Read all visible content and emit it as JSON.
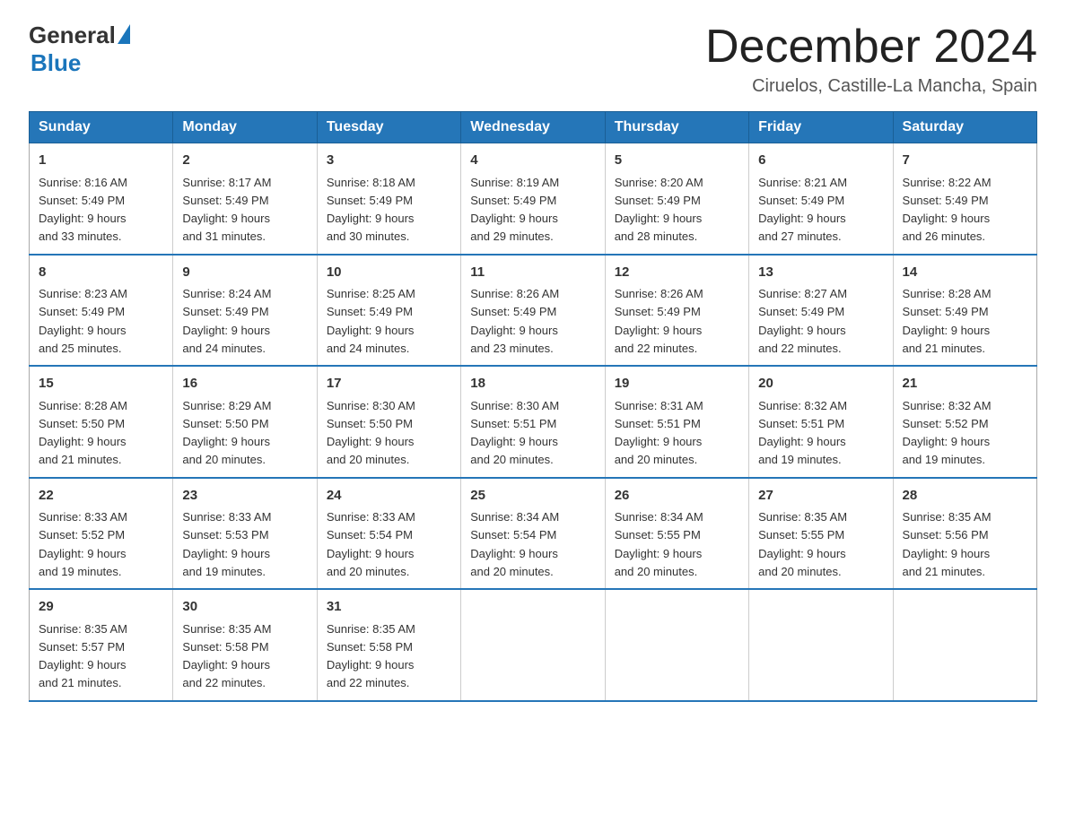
{
  "logo": {
    "general": "General",
    "blue": "Blue"
  },
  "title": {
    "month": "December 2024",
    "location": "Ciruelos, Castille-La Mancha, Spain"
  },
  "headers": [
    "Sunday",
    "Monday",
    "Tuesday",
    "Wednesday",
    "Thursday",
    "Friday",
    "Saturday"
  ],
  "weeks": [
    [
      {
        "day": "1",
        "sunrise": "8:16 AM",
        "sunset": "5:49 PM",
        "daylight": "9 hours and 33 minutes."
      },
      {
        "day": "2",
        "sunrise": "8:17 AM",
        "sunset": "5:49 PM",
        "daylight": "9 hours and 31 minutes."
      },
      {
        "day": "3",
        "sunrise": "8:18 AM",
        "sunset": "5:49 PM",
        "daylight": "9 hours and 30 minutes."
      },
      {
        "day": "4",
        "sunrise": "8:19 AM",
        "sunset": "5:49 PM",
        "daylight": "9 hours and 29 minutes."
      },
      {
        "day": "5",
        "sunrise": "8:20 AM",
        "sunset": "5:49 PM",
        "daylight": "9 hours and 28 minutes."
      },
      {
        "day": "6",
        "sunrise": "8:21 AM",
        "sunset": "5:49 PM",
        "daylight": "9 hours and 27 minutes."
      },
      {
        "day": "7",
        "sunrise": "8:22 AM",
        "sunset": "5:49 PM",
        "daylight": "9 hours and 26 minutes."
      }
    ],
    [
      {
        "day": "8",
        "sunrise": "8:23 AM",
        "sunset": "5:49 PM",
        "daylight": "9 hours and 25 minutes."
      },
      {
        "day": "9",
        "sunrise": "8:24 AM",
        "sunset": "5:49 PM",
        "daylight": "9 hours and 24 minutes."
      },
      {
        "day": "10",
        "sunrise": "8:25 AM",
        "sunset": "5:49 PM",
        "daylight": "9 hours and 24 minutes."
      },
      {
        "day": "11",
        "sunrise": "8:26 AM",
        "sunset": "5:49 PM",
        "daylight": "9 hours and 23 minutes."
      },
      {
        "day": "12",
        "sunrise": "8:26 AM",
        "sunset": "5:49 PM",
        "daylight": "9 hours and 22 minutes."
      },
      {
        "day": "13",
        "sunrise": "8:27 AM",
        "sunset": "5:49 PM",
        "daylight": "9 hours and 22 minutes."
      },
      {
        "day": "14",
        "sunrise": "8:28 AM",
        "sunset": "5:49 PM",
        "daylight": "9 hours and 21 minutes."
      }
    ],
    [
      {
        "day": "15",
        "sunrise": "8:28 AM",
        "sunset": "5:50 PM",
        "daylight": "9 hours and 21 minutes."
      },
      {
        "day": "16",
        "sunrise": "8:29 AM",
        "sunset": "5:50 PM",
        "daylight": "9 hours and 20 minutes."
      },
      {
        "day": "17",
        "sunrise": "8:30 AM",
        "sunset": "5:50 PM",
        "daylight": "9 hours and 20 minutes."
      },
      {
        "day": "18",
        "sunrise": "8:30 AM",
        "sunset": "5:51 PM",
        "daylight": "9 hours and 20 minutes."
      },
      {
        "day": "19",
        "sunrise": "8:31 AM",
        "sunset": "5:51 PM",
        "daylight": "9 hours and 20 minutes."
      },
      {
        "day": "20",
        "sunrise": "8:32 AM",
        "sunset": "5:51 PM",
        "daylight": "9 hours and 19 minutes."
      },
      {
        "day": "21",
        "sunrise": "8:32 AM",
        "sunset": "5:52 PM",
        "daylight": "9 hours and 19 minutes."
      }
    ],
    [
      {
        "day": "22",
        "sunrise": "8:33 AM",
        "sunset": "5:52 PM",
        "daylight": "9 hours and 19 minutes."
      },
      {
        "day": "23",
        "sunrise": "8:33 AM",
        "sunset": "5:53 PM",
        "daylight": "9 hours and 19 minutes."
      },
      {
        "day": "24",
        "sunrise": "8:33 AM",
        "sunset": "5:54 PM",
        "daylight": "9 hours and 20 minutes."
      },
      {
        "day": "25",
        "sunrise": "8:34 AM",
        "sunset": "5:54 PM",
        "daylight": "9 hours and 20 minutes."
      },
      {
        "day": "26",
        "sunrise": "8:34 AM",
        "sunset": "5:55 PM",
        "daylight": "9 hours and 20 minutes."
      },
      {
        "day": "27",
        "sunrise": "8:35 AM",
        "sunset": "5:55 PM",
        "daylight": "9 hours and 20 minutes."
      },
      {
        "day": "28",
        "sunrise": "8:35 AM",
        "sunset": "5:56 PM",
        "daylight": "9 hours and 21 minutes."
      }
    ],
    [
      {
        "day": "29",
        "sunrise": "8:35 AM",
        "sunset": "5:57 PM",
        "daylight": "9 hours and 21 minutes."
      },
      {
        "day": "30",
        "sunrise": "8:35 AM",
        "sunset": "5:58 PM",
        "daylight": "9 hours and 22 minutes."
      },
      {
        "day": "31",
        "sunrise": "8:35 AM",
        "sunset": "5:58 PM",
        "daylight": "9 hours and 22 minutes."
      },
      null,
      null,
      null,
      null
    ]
  ],
  "colors": {
    "header_bg": "#2576b8",
    "header_text": "#ffffff",
    "border_blue": "#2576b8"
  }
}
